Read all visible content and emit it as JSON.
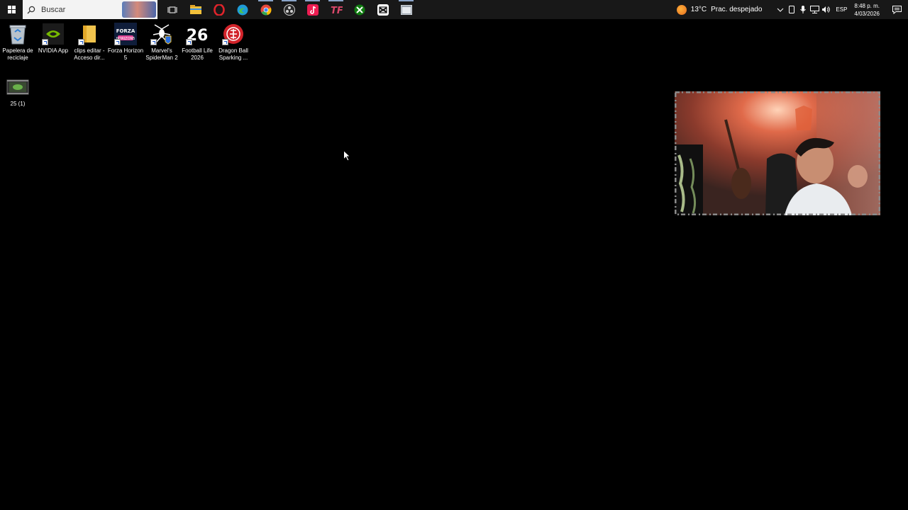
{
  "taskbar": {
    "search_placeholder": "Buscar",
    "pinned_apps": [
      {
        "name": "task-view-icon",
        "color": "#ffffff"
      },
      {
        "name": "file-explorer-icon",
        "color": "#f3c13a"
      },
      {
        "name": "opera-icon",
        "color": "#e0242b"
      },
      {
        "name": "edge-icon",
        "color": "#1f9cd8"
      },
      {
        "name": "chrome-icon",
        "color": "#e5483c"
      },
      {
        "name": "obs-icon",
        "color": "#d0d0d0"
      },
      {
        "name": "tiktok-icon",
        "color": "#ee1d52"
      },
      {
        "name": "tf-icon",
        "color": "#d9486a"
      },
      {
        "name": "xbox-icon",
        "color": "#107c10"
      },
      {
        "name": "capcut-icon",
        "color": "#ffffff"
      },
      {
        "name": "app-window-icon",
        "color": "#9aa3ad"
      }
    ],
    "weather": {
      "temperature": "13°C",
      "condition": "Prac. despejado"
    },
    "language": "ESP",
    "clock": {
      "time": "8:48 p. m.",
      "date": "4/03/2026"
    }
  },
  "desktop": {
    "icons": [
      {
        "label": "Papelera de reciclaje",
        "icon": "recycle-bin-icon"
      },
      {
        "label": "NVIDIA App",
        "icon": "nvidia-icon"
      },
      {
        "label": "clips editar - Acceso dir...",
        "icon": "folder-shortcut-icon"
      },
      {
        "label": "Forza Horizon 5",
        "icon": "forza-horizon-icon"
      },
      {
        "label": "Marvel's SpiderMan 2",
        "icon": "spiderman-icon"
      },
      {
        "label": "Football Life 2026",
        "icon": "football-life-icon",
        "badge": "26"
      },
      {
        "label": "Dragon Ball Sparking ...",
        "icon": "dragon-ball-icon"
      },
      {
        "label": "25 (1)",
        "icon": "video-file-icon"
      }
    ]
  },
  "colors": {
    "taskbar_bg": "#181818",
    "desktop_bg": "#000000",
    "accent": "#8aa4c8"
  }
}
